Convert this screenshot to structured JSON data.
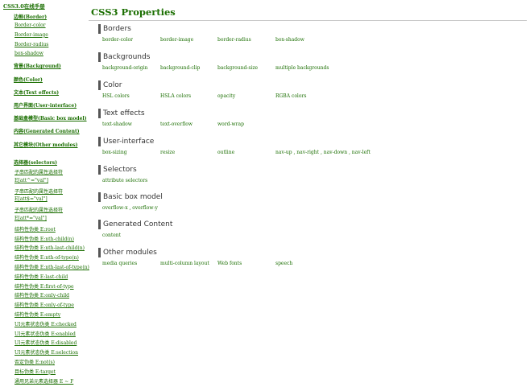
{
  "sidebar": {
    "title": "CSS3.0在线手册",
    "groups": [
      {
        "label": "边框(Border)",
        "items": [
          "Border-color",
          "Border-image",
          "Border-radius",
          "box-shadow"
        ]
      },
      {
        "label": "背景(Background)",
        "items": []
      },
      {
        "label": "颜色(Color)",
        "items": []
      },
      {
        "label": "文本(Text effects)",
        "items": []
      },
      {
        "label": "用户界面(User-interface)",
        "items": []
      },
      {
        "label": "基础盒模型(Basic box model)",
        "items": []
      },
      {
        "label": "内容(Generated Content)",
        "items": []
      },
      {
        "label": "其它模块(Other modules)",
        "items": []
      },
      {
        "label": "选择器(selectors)",
        "items": [
          "子串匹配的属性选择符",
          "E[att^=\"val\"]",
          "子串匹配的属性选择符",
          "E[att$=\"val\"]",
          "子串匹配的属性选择符",
          "E[att*=\"val\"]",
          "结构性伪类 E:root",
          "结构性伪类 E:nth-child(n)",
          "结构性伪类 E:nth-last-child(n)",
          "结构性伪类 E:nth-of-type(n)",
          "结构性伪类 E:nth-last-of-type(n)",
          "结构性伪类 E:last-child",
          "结构性伪类 E:first-of-type",
          "结构性伪类 E:only-child",
          "结构性伪类 E:only-of-type",
          "结构性伪类 E:empty",
          "UI元素状态伪类 E:checked",
          "UI元素状态伪类 E:enabled",
          "UI元素状态伪类 E:disabled",
          "UI元素状态伪类 E:selection",
          "否定伪类 E:not(s)",
          "目标伪类 E:target",
          "通用兄弟元素选择器 E ~ F"
        ]
      }
    ]
  },
  "main": {
    "title": "CSS3 Properties",
    "sections": [
      {
        "heading": "Borders",
        "items": [
          "border-color",
          "border-image",
          "border-radius",
          "box-shadow"
        ]
      },
      {
        "heading": "Backgrounds",
        "items": [
          "background-origin",
          "background-clip",
          "background-size",
          "multiple backgrounds"
        ]
      },
      {
        "heading": "Color",
        "items": [
          "HSL colors",
          "HSLA colors",
          "opacity",
          "RGBA colors"
        ]
      },
      {
        "heading": "Text effects",
        "items": [
          "text-shadow",
          "text-overflow",
          "word-wrap"
        ]
      },
      {
        "heading": "User-interface",
        "items": [
          "box-sizing",
          "resize",
          "outline",
          "nav-up , nav-right , nav-down , nav-left"
        ]
      },
      {
        "heading": "Selectors",
        "items": [
          "attribute selectors"
        ]
      },
      {
        "heading": "Basic box model",
        "items": [
          "overflow-x , overflow-y"
        ]
      },
      {
        "heading": "Generated Content",
        "items": [
          "content"
        ]
      },
      {
        "heading": "Other modules",
        "items": [
          "media queries",
          "multi-column layout",
          "Web fonts",
          "speech"
        ]
      }
    ]
  },
  "colors": {
    "link": "#1a6e00",
    "rule": "#c9c9c9",
    "heading_bar": "#555555"
  }
}
